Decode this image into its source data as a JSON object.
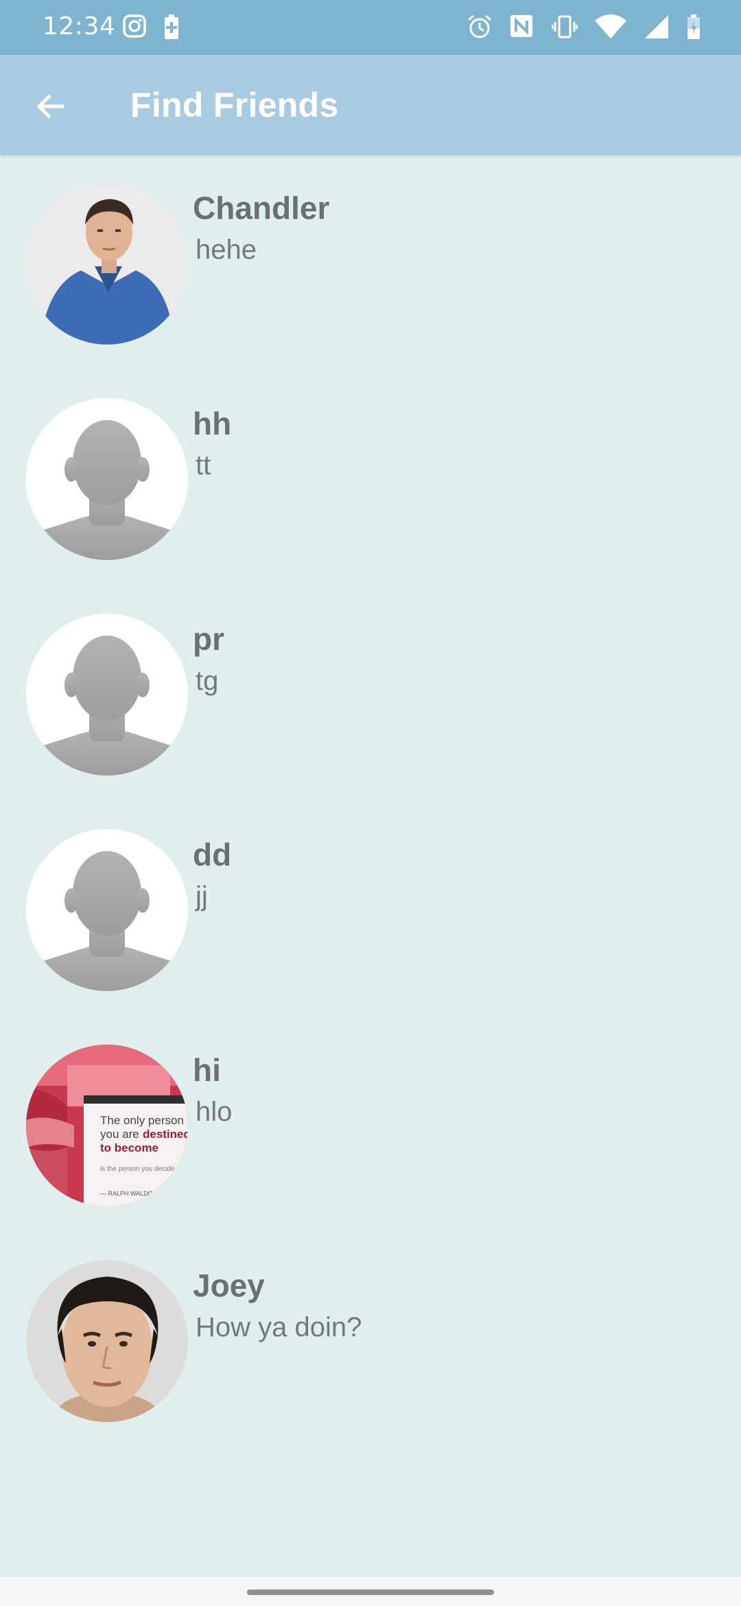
{
  "status_bar": {
    "time": "12:34",
    "left_icons": [
      "instagram-icon",
      "battery-saver-icon"
    ],
    "right_icons": [
      "alarm-icon",
      "nfc-icon",
      "vibrate-icon",
      "wifi-icon",
      "signal-icon",
      "battery-icon"
    ]
  },
  "app_bar": {
    "title": "Find Friends",
    "back_icon": "arrow-back-icon"
  },
  "friends": [
    {
      "name": "Chandler",
      "status": "hehe",
      "avatar": "photo-man-blue-shirt"
    },
    {
      "name": "hh",
      "status": "tt",
      "avatar": "default-silhouette"
    },
    {
      "name": "pr",
      "status": "tg",
      "avatar": "default-silhouette"
    },
    {
      "name": "dd",
      "status": "jj",
      "avatar": "default-silhouette"
    },
    {
      "name": "hi",
      "status": "hlo",
      "avatar": "quote-card-photo",
      "avatar_text": [
        "The only person",
        "you are",
        "destined",
        "to become",
        "is the person you decide",
        "— RALPH WALDO"
      ]
    },
    {
      "name": "Joey",
      "status": "How ya doin?",
      "avatar": "photo-man-dark-hair"
    }
  ],
  "colors": {
    "status_bar": "#7fb4d1",
    "app_bar": "#a9cbe2",
    "background": "#e0eeee",
    "name_text": "#6b6f70",
    "status_text": "#757879"
  }
}
